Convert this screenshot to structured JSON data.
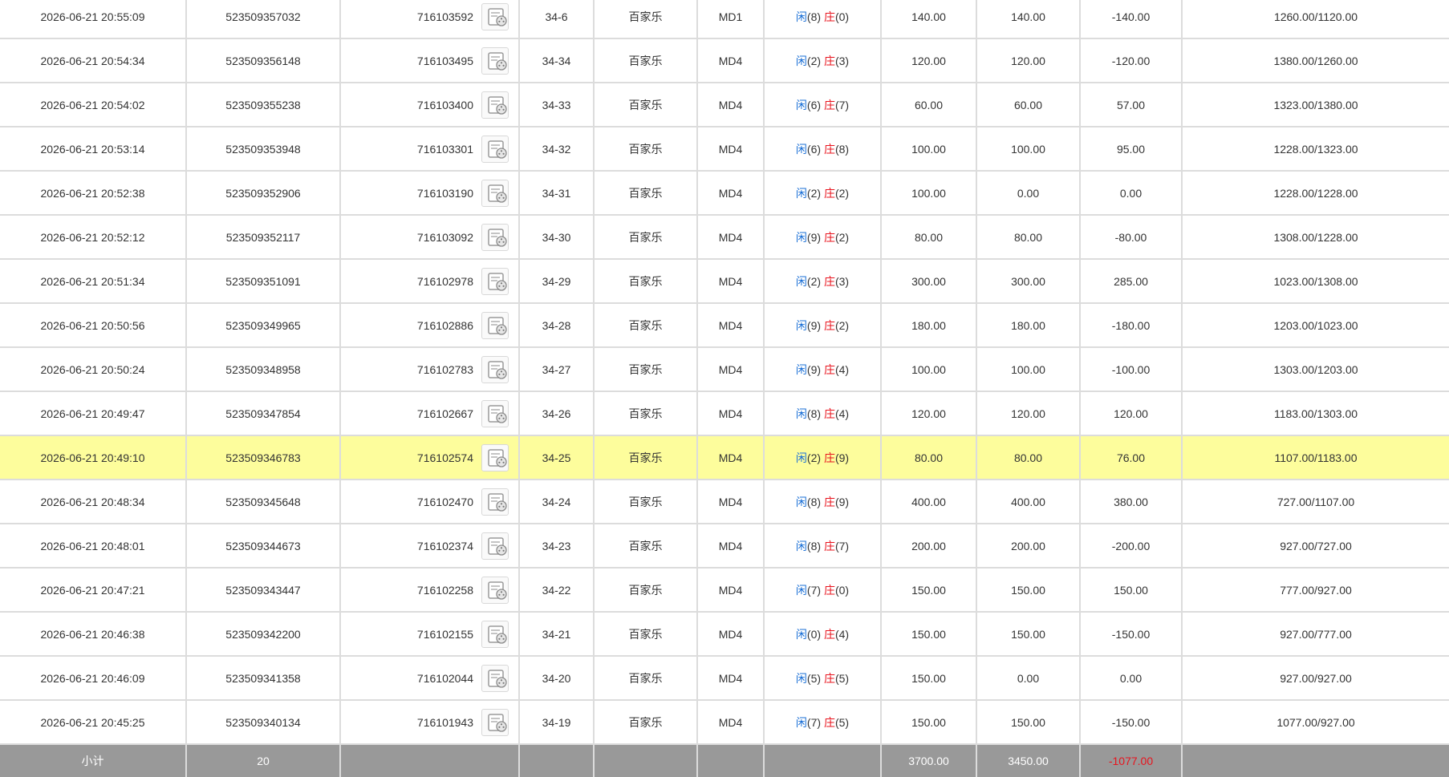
{
  "colors": {
    "player": "#1a6fd6",
    "banker": "#e8141e",
    "bet": "#1a6fd6",
    "negative": "#e8141e",
    "highlight": "#fdfd9c",
    "subtotal_bg": "#999999"
  },
  "labels": {
    "player": "闲",
    "banker": "庄"
  },
  "rows": [
    {
      "time": "2026-06-21 20:55:09",
      "order": "523509357032",
      "game": "716103592",
      "shoe": "34-6",
      "type": "百家乐",
      "table": "MD1",
      "player": "8",
      "banker": "0",
      "bet": "140.00",
      "valid": "140.00",
      "winloss": "-140.00",
      "negative": true,
      "balance": "1260.00/1120.00",
      "highlight": false
    },
    {
      "time": "2026-06-21 20:54:34",
      "order": "523509356148",
      "game": "716103495",
      "shoe": "34-34",
      "type": "百家乐",
      "table": "MD4",
      "player": "2",
      "banker": "3",
      "bet": "120.00",
      "valid": "120.00",
      "winloss": "-120.00",
      "negative": true,
      "balance": "1380.00/1260.00",
      "highlight": false
    },
    {
      "time": "2026-06-21 20:54:02",
      "order": "523509355238",
      "game": "716103400",
      "shoe": "34-33",
      "type": "百家乐",
      "table": "MD4",
      "player": "6",
      "banker": "7",
      "bet": "60.00",
      "valid": "60.00",
      "winloss": "57.00",
      "negative": false,
      "balance": "1323.00/1380.00",
      "highlight": false
    },
    {
      "time": "2026-06-21 20:53:14",
      "order": "523509353948",
      "game": "716103301",
      "shoe": "34-32",
      "type": "百家乐",
      "table": "MD4",
      "player": "6",
      "banker": "8",
      "bet": "100.00",
      "valid": "100.00",
      "winloss": "95.00",
      "negative": false,
      "balance": "1228.00/1323.00",
      "highlight": false
    },
    {
      "time": "2026-06-21 20:52:38",
      "order": "523509352906",
      "game": "716103190",
      "shoe": "34-31",
      "type": "百家乐",
      "table": "MD4",
      "player": "2",
      "banker": "2",
      "bet": "100.00",
      "valid": "0.00",
      "winloss": "0.00",
      "negative": false,
      "balance": "1228.00/1228.00",
      "highlight": false
    },
    {
      "time": "2026-06-21 20:52:12",
      "order": "523509352117",
      "game": "716103092",
      "shoe": "34-30",
      "type": "百家乐",
      "table": "MD4",
      "player": "9",
      "banker": "2",
      "bet": "80.00",
      "valid": "80.00",
      "winloss": "-80.00",
      "negative": true,
      "balance": "1308.00/1228.00",
      "highlight": false
    },
    {
      "time": "2026-06-21 20:51:34",
      "order": "523509351091",
      "game": "716102978",
      "shoe": "34-29",
      "type": "百家乐",
      "table": "MD4",
      "player": "2",
      "banker": "3",
      "bet": "300.00",
      "valid": "300.00",
      "winloss": "285.00",
      "negative": false,
      "balance": "1023.00/1308.00",
      "highlight": false
    },
    {
      "time": "2026-06-21 20:50:56",
      "order": "523509349965",
      "game": "716102886",
      "shoe": "34-28",
      "type": "百家乐",
      "table": "MD4",
      "player": "9",
      "banker": "2",
      "bet": "180.00",
      "valid": "180.00",
      "winloss": "-180.00",
      "negative": true,
      "balance": "1203.00/1023.00",
      "highlight": false
    },
    {
      "time": "2026-06-21 20:50:24",
      "order": "523509348958",
      "game": "716102783",
      "shoe": "34-27",
      "type": "百家乐",
      "table": "MD4",
      "player": "9",
      "banker": "4",
      "bet": "100.00",
      "valid": "100.00",
      "winloss": "-100.00",
      "negative": true,
      "balance": "1303.00/1203.00",
      "highlight": false
    },
    {
      "time": "2026-06-21 20:49:47",
      "order": "523509347854",
      "game": "716102667",
      "shoe": "34-26",
      "type": "百家乐",
      "table": "MD4",
      "player": "8",
      "banker": "4",
      "bet": "120.00",
      "valid": "120.00",
      "winloss": "120.00",
      "negative": false,
      "balance": "1183.00/1303.00",
      "highlight": false
    },
    {
      "time": "2026-06-21 20:49:10",
      "order": "523509346783",
      "game": "716102574",
      "shoe": "34-25",
      "type": "百家乐",
      "table": "MD4",
      "player": "2",
      "banker": "9",
      "bet": "80.00",
      "valid": "80.00",
      "winloss": "76.00",
      "negative": false,
      "balance": "1107.00/1183.00",
      "highlight": true
    },
    {
      "time": "2026-06-21 20:48:34",
      "order": "523509345648",
      "game": "716102470",
      "shoe": "34-24",
      "type": "百家乐",
      "table": "MD4",
      "player": "8",
      "banker": "9",
      "bet": "400.00",
      "valid": "400.00",
      "winloss": "380.00",
      "negative": false,
      "balance": "727.00/1107.00",
      "highlight": false
    },
    {
      "time": "2026-06-21 20:48:01",
      "order": "523509344673",
      "game": "716102374",
      "shoe": "34-23",
      "type": "百家乐",
      "table": "MD4",
      "player": "8",
      "banker": "7",
      "bet": "200.00",
      "valid": "200.00",
      "winloss": "-200.00",
      "negative": true,
      "balance": "927.00/727.00",
      "highlight": false
    },
    {
      "time": "2026-06-21 20:47:21",
      "order": "523509343447",
      "game": "716102258",
      "shoe": "34-22",
      "type": "百家乐",
      "table": "MD4",
      "player": "7",
      "banker": "0",
      "bet": "150.00",
      "valid": "150.00",
      "winloss": "150.00",
      "negative": false,
      "balance": "777.00/927.00",
      "highlight": false
    },
    {
      "time": "2026-06-21 20:46:38",
      "order": "523509342200",
      "game": "716102155",
      "shoe": "34-21",
      "type": "百家乐",
      "table": "MD4",
      "player": "0",
      "banker": "4",
      "bet": "150.00",
      "valid": "150.00",
      "winloss": "-150.00",
      "negative": true,
      "balance": "927.00/777.00",
      "highlight": false
    },
    {
      "time": "2026-06-21 20:46:09",
      "order": "523509341358",
      "game": "716102044",
      "shoe": "34-20",
      "type": "百家乐",
      "table": "MD4",
      "player": "5",
      "banker": "5",
      "bet": "150.00",
      "valid": "0.00",
      "winloss": "0.00",
      "negative": false,
      "balance": "927.00/927.00",
      "highlight": false
    },
    {
      "time": "2026-06-21 20:45:25",
      "order": "523509340134",
      "game": "716101943",
      "shoe": "34-19",
      "type": "百家乐",
      "table": "MD4",
      "player": "7",
      "banker": "5",
      "bet": "150.00",
      "valid": "150.00",
      "winloss": "-150.00",
      "negative": true,
      "balance": "1077.00/927.00",
      "highlight": false
    }
  ],
  "subtotal": {
    "label": "小计",
    "count": "20",
    "bet": "3700.00",
    "valid": "3450.00",
    "winloss": "-1077.00"
  }
}
